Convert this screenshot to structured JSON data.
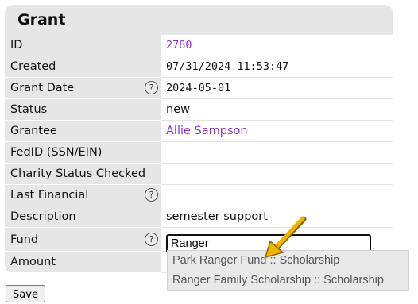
{
  "panel": {
    "title": "Grant"
  },
  "fields": [
    {
      "label": "ID",
      "value": "2780",
      "help": false
    },
    {
      "label": "Created",
      "value": "07/31/2024 11:53:47",
      "help": false
    },
    {
      "label": "Grant Date",
      "value": "2024-05-01",
      "help": true
    },
    {
      "label": "Status",
      "value": "new",
      "help": false
    },
    {
      "label": "Grantee",
      "value": "Allie Sampson",
      "help": false
    },
    {
      "label": "FedID (SSN/EIN)",
      "value": "",
      "help": false
    },
    {
      "label": "Charity Status Checked",
      "value": "",
      "help": false
    },
    {
      "label": "Last Financial",
      "value": "",
      "help": true
    },
    {
      "label": "Description",
      "value": "semester support",
      "help": false
    },
    {
      "label": "Fund",
      "value": "Ranger",
      "help": true
    },
    {
      "label": "Amount",
      "value": "",
      "help": false
    }
  ],
  "help_icon": {
    "glyph": "?"
  },
  "autocomplete": {
    "options": [
      "Park Ranger Fund :: Scholarship",
      "Ranger Family Scholarship :: Scholarship"
    ]
  },
  "save_label": "Save",
  "colors": {
    "link": "#8a35c8",
    "arrow": "#f0b400",
    "label_bg": "#e6e6e6"
  }
}
